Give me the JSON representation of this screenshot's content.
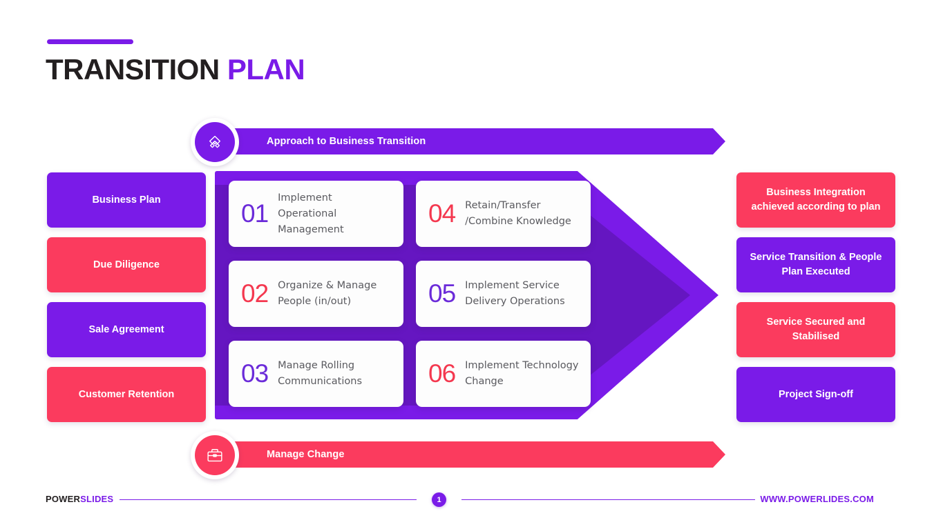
{
  "title": {
    "part1": "TRANSITION ",
    "part2": "PLAN"
  },
  "banners": {
    "top": {
      "label": "Approach to Business Transition",
      "icon": "handshake-icon",
      "color": "#7A1BE8"
    },
    "bottom": {
      "label": "Manage Change",
      "icon": "briefcase-icon",
      "color": "#FB3B5E"
    }
  },
  "left_column": [
    {
      "label": "Business Plan",
      "color": "#7A1BE8"
    },
    {
      "label": "Due Diligence",
      "color": "#FB3B5E"
    },
    {
      "label": "Sale Agreement",
      "color": "#7A1BE8"
    },
    {
      "label": "Customer Retention",
      "color": "#FB3B5E"
    }
  ],
  "steps": [
    {
      "number": "01",
      "number_color": "#6B2BD9",
      "text": "Implement Operational Management"
    },
    {
      "number": "02",
      "number_color": "#F4384F",
      "text": "Organize & Manage People (in/out)"
    },
    {
      "number": "03",
      "number_color": "#6B2BD9",
      "text": "Manage Rolling Communications"
    },
    {
      "number": "04",
      "number_color": "#F4384F",
      "text": "Retain/Transfer /Combine Knowledge"
    },
    {
      "number": "05",
      "number_color": "#6B2BD9",
      "text": "Implement Service Delivery Operations"
    },
    {
      "number": "06",
      "number_color": "#F4384F",
      "text": "Implement Technology Change"
    }
  ],
  "right_column": [
    {
      "label": "Business Integration achieved according to plan",
      "color": "#FB3B5E"
    },
    {
      "label": "Service Transition & People Plan Executed",
      "color": "#7A1BE8"
    },
    {
      "label": "Service Secured and Stabilised",
      "color": "#FB3B5E"
    },
    {
      "label": "Project Sign-off",
      "color": "#7A1BE8"
    }
  ],
  "footer": {
    "logo_part1": "POWER",
    "logo_part2": "SLIDES",
    "page_number": "1",
    "url": "WWW.POWERLIDES.COM"
  },
  "theme": {
    "purple": "#7A1BE8",
    "red": "#FB3B5E",
    "dark": "#231f20"
  }
}
